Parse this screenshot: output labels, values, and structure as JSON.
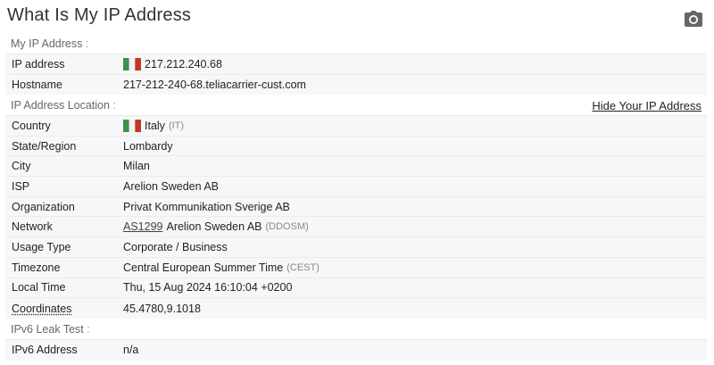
{
  "page": {
    "title": "What Is My IP Address"
  },
  "my_ip": {
    "section_label": "My IP Address",
    "rows": [
      {
        "key": "IP address",
        "value": "217.212.240.68"
      },
      {
        "key": "Hostname",
        "value": "217-212-240-68.teliacarrier-cust.com"
      }
    ]
  },
  "location": {
    "section_label": "IP Address Location",
    "hide_link": "Hide Your IP Address",
    "country": {
      "key": "Country",
      "value": "Italy",
      "code": "(IT)"
    },
    "state": {
      "key": "State/Region",
      "value": "Lombardy"
    },
    "city": {
      "key": "City",
      "value": "Milan"
    },
    "isp": {
      "key": "ISP",
      "value": "Arelion Sweden AB"
    },
    "organization": {
      "key": "Organization",
      "value": "Privat Kommunikation Sverige AB"
    },
    "network": {
      "key": "Network",
      "asn": "AS1299",
      "value": "Arelion Sweden AB",
      "code": "(DDOSM)"
    },
    "usage_type": {
      "key": "Usage Type",
      "value": "Corporate / Business"
    },
    "timezone": {
      "key": "Timezone",
      "value": "Central European Summer Time",
      "code": "(CEST)"
    },
    "local_time": {
      "key": "Local Time",
      "value": "Thu, 15 Aug 2024 16:10:04 +0200"
    },
    "coordinates": {
      "key": "Coordinates",
      "value": "45.4780,9.1018"
    }
  },
  "ipv6": {
    "section_label": "IPv6 Leak Test",
    "rows": [
      {
        "key": "IPv6 Address",
        "value": "n/a"
      }
    ]
  },
  "colors": {
    "flag_green": "#3f8f4e",
    "flag_white": "#f2f2f2",
    "flag_red": "#c0392b",
    "table_bg": "#f6f7f9"
  },
  "icons": {
    "camera": "camera-icon",
    "flag": "italy-flag-icon"
  }
}
